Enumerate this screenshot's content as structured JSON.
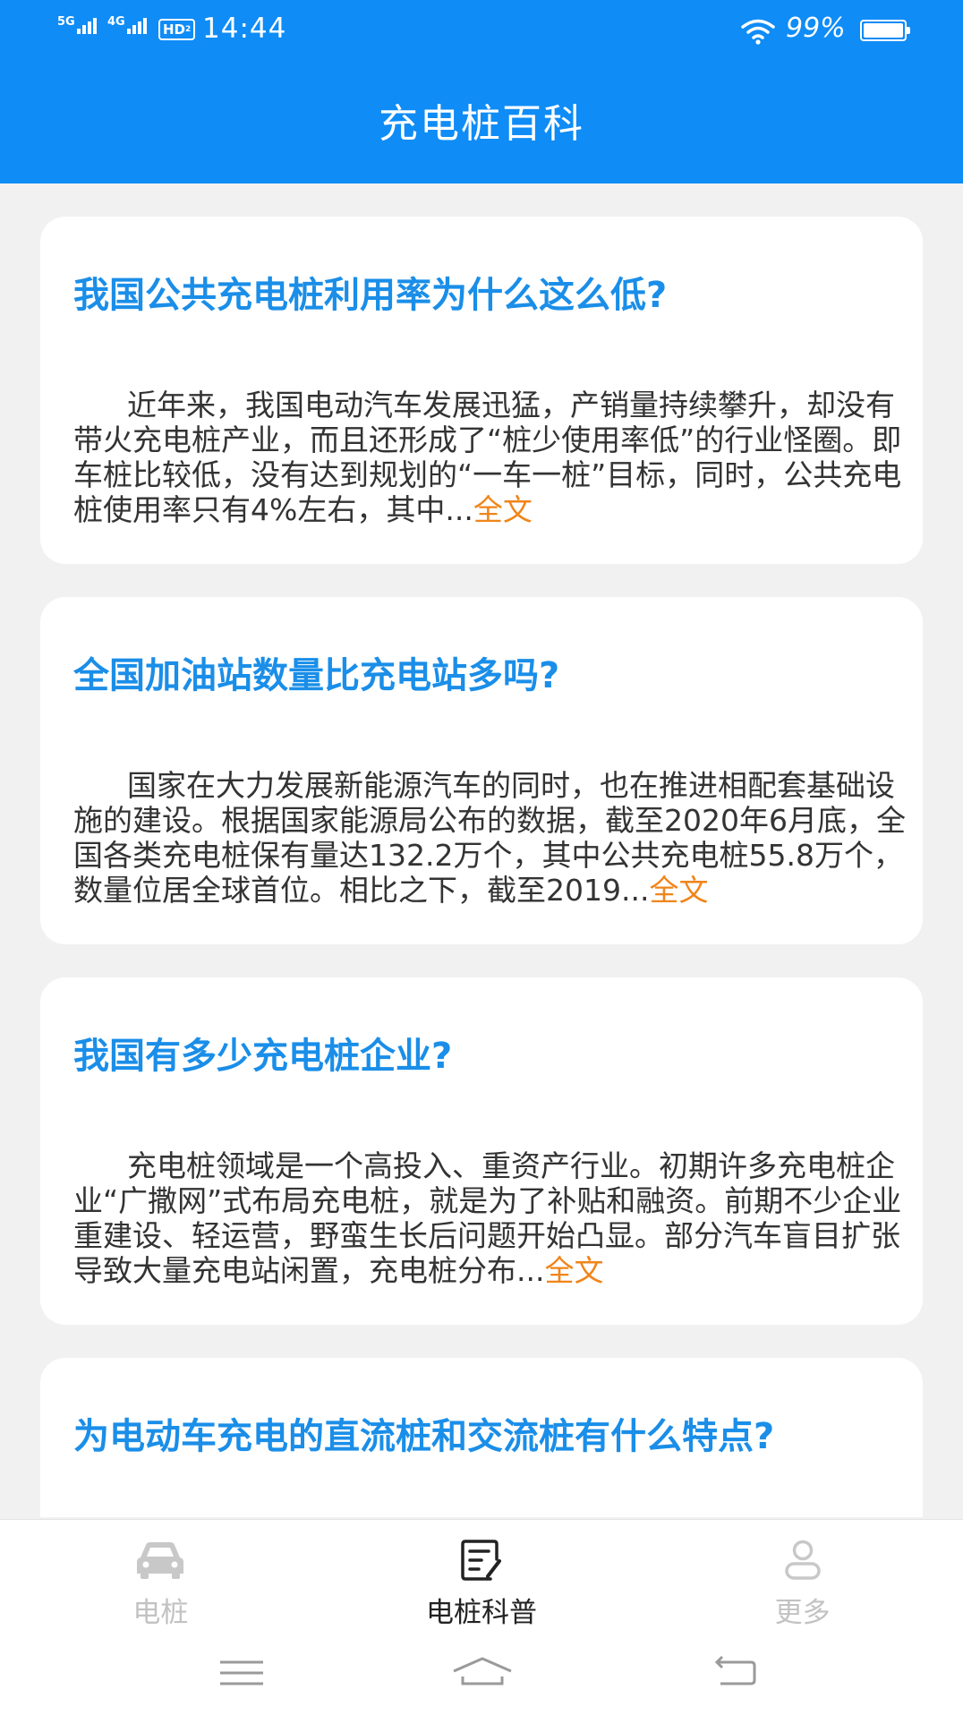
{
  "status_bar": {
    "network_1": "5G",
    "network_2": "4G",
    "hd_label": "HD",
    "hd_sub": "2",
    "time": "14:44",
    "battery_text": "99%",
    "battery_level": 0.99
  },
  "header": {
    "title": "充电桩百科"
  },
  "articles": [
    {
      "title": "我国公共充电桩利用率为什么这么低?",
      "excerpt": "近年来，我国电动汽车发展迅猛，产销量持续攀升，却没有带火充电桩产业，而且还形成了“桩少使用率低”的行业怪圈。即车桩比较低，没有达到规划的“一车一桩”目标，同时，公共充电桩使用率只有4%左右，其中...",
      "more_label": "全文"
    },
    {
      "title": "全国加油站数量比充电站多吗?",
      "excerpt": "国家在大力发展新能源汽车的同时，也在推进相配套基础设施的建设。根据国家能源局公布的数据，截至2020年6月底，全国各类充电桩保有量达132.2万个，其中公共充电桩55.8万个，数量位居全球首位。相比之下，截至2019...",
      "more_label": "全文"
    },
    {
      "title": "我国有多少充电桩企业?",
      "excerpt": "充电桩领域是一个高投入、重资产行业。初期许多充电桩企业“广撒网”式布局充电桩，就是为了补贴和融资。前期不少企业重建设、轻运营，野蛮生长后问题开始凸显。部分汽车盲目扩张导致大量充电站闲置，充电桩分布...",
      "more_label": "全文"
    },
    {
      "title": "为电动车充电的直流桩和交流桩有什么特点?"
    }
  ],
  "tabbar": {
    "tabs": [
      {
        "label": "电桩",
        "icon": "car-icon",
        "active": false
      },
      {
        "label": "电桩科普",
        "icon": "article-icon",
        "active": true
      },
      {
        "label": "更多",
        "icon": "user-icon",
        "active": false
      }
    ]
  },
  "colors": {
    "header_bg": "#0f8cf6",
    "title_blue": "#1a8ee8",
    "more_orange": "#f08519",
    "tab_inactive": "#c2c2c2",
    "tab_active": "#222222"
  }
}
